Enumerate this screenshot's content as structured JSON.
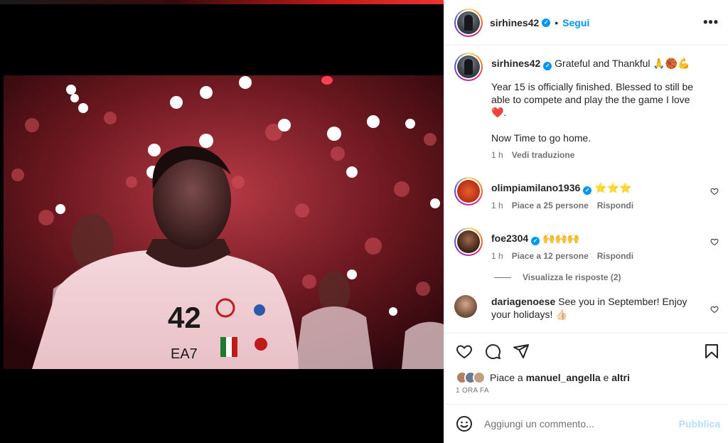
{
  "post": {
    "author": "sirhines42",
    "follow_label": "Segui",
    "dot": "•",
    "more": "•••",
    "verified_mark": "✓"
  },
  "caption": {
    "username": "sirhines42",
    "title": "Grateful and Thankful 🙏🏀💪",
    "para1": "Year 15 is officially finished. Blessed to still be able to compete and play the the game I love ❤️.",
    "para2": "Now Time to go home.",
    "time": "1 h",
    "translate": "Vedi traduzione"
  },
  "comments": [
    {
      "username": "olimpiamilano1936",
      "text": "⭐⭐⭐",
      "time": "1 h",
      "likes": "Piace a 25 persone",
      "reply": "Rispondi",
      "verified": true
    },
    {
      "username": "foe2304",
      "text": "🙌🙌🙌",
      "time": "1 h",
      "likes": "Piace a 12 persone",
      "reply": "Rispondi",
      "verified": true,
      "view_replies": "Visualizza le risposte (2)"
    },
    {
      "username": "dariagenoese",
      "text": "See you in September! Enjoy your holidays! 👍🏻"
    }
  ],
  "likes": {
    "prefix": "Piace a",
    "user": "manuel_angella",
    "joiner": "e",
    "others": "altri"
  },
  "timestamp": "1 ORA FA",
  "add_comment": {
    "placeholder": "Aggiungi un commento...",
    "post_label": "Pubblica"
  },
  "icons": [
    "heart-icon",
    "comment-icon",
    "share-icon",
    "bookmark-icon",
    "emoji-icon",
    "more-icon"
  ],
  "colors": {
    "accent": "#0095f6",
    "text": "#262626",
    "muted": "#737373",
    "post_disabled": "#b2dffc"
  }
}
